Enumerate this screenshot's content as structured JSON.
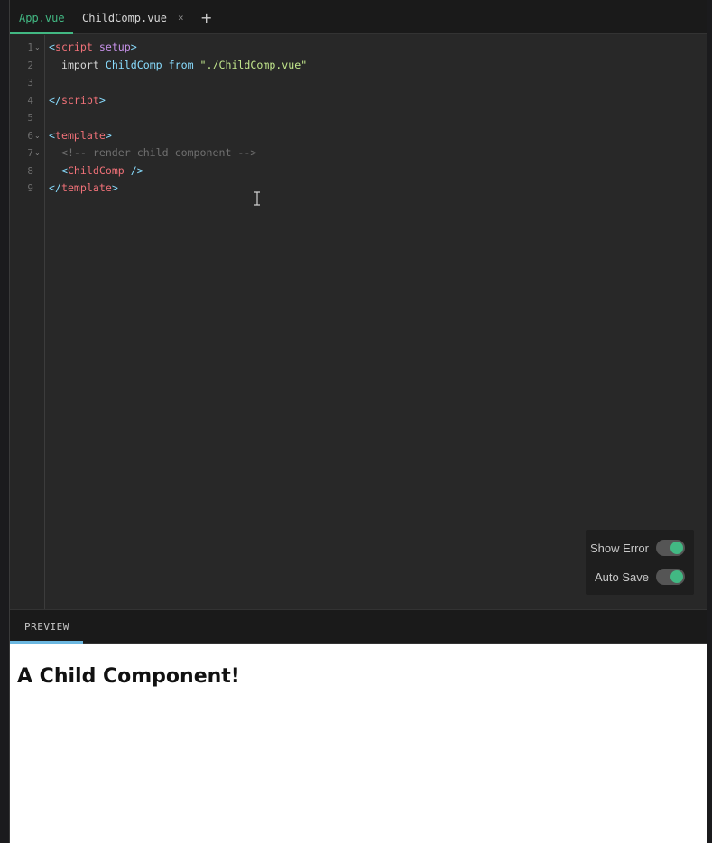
{
  "tabs": [
    {
      "label": "App.vue",
      "active": true
    },
    {
      "label": "ChildComp.vue",
      "active": false
    }
  ],
  "tab_close": "×",
  "tab_add": "+",
  "editor": {
    "line_numbers": [
      "1",
      "2",
      "3",
      "4",
      "5",
      "6",
      "7",
      "8",
      "9"
    ],
    "lines": {
      "l1": {
        "open": "<",
        "tag": "script",
        "attr": " setup",
        "close": ">"
      },
      "l2": {
        "indent": "  ",
        "kw_import": "import",
        "ident": " ChildComp ",
        "kw_from": "from",
        "space": " ",
        "str": "\"./ChildComp.vue\""
      },
      "l4": {
        "open": "</",
        "tag": "script",
        "close": ">"
      },
      "l6": {
        "open": "<",
        "tag": "template",
        "close": ">"
      },
      "l7": {
        "comment": "  <!-- render child component -->"
      },
      "l8": {
        "indent": "  ",
        "open": "<",
        "tag": "ChildComp",
        "close": " />"
      },
      "l9": {
        "open": "</",
        "tag": "template",
        "close": ">"
      }
    }
  },
  "toggles": [
    {
      "label": "Show Error",
      "on": true
    },
    {
      "label": "Auto Save",
      "on": true
    }
  ],
  "colors": {
    "accent": "#42b883",
    "preview_accent": "#6bb7e0"
  },
  "preview": {
    "tab_label": "PREVIEW",
    "heading": "A Child Component!"
  }
}
